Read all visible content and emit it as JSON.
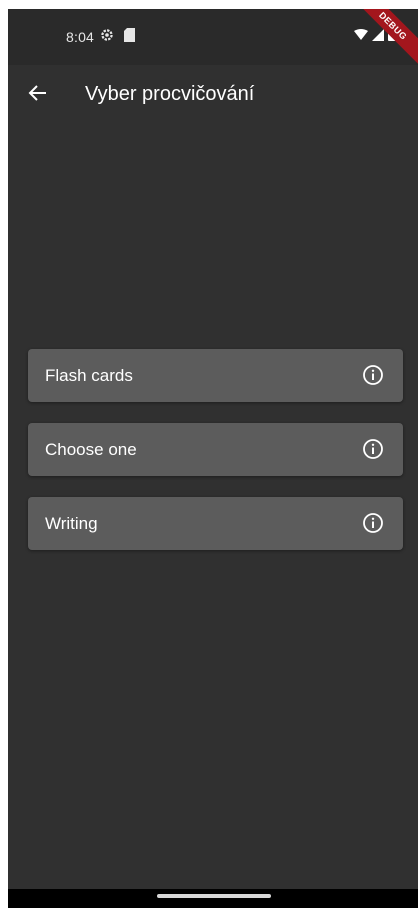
{
  "status_bar": {
    "time": "8:04",
    "left_icons": [
      "settings-gear-icon",
      "sd-card-icon"
    ],
    "right_icons": [
      "wifi-icon",
      "signal-icon",
      "battery-icon"
    ],
    "debug_label": "DEBUG"
  },
  "app_bar": {
    "back_icon": "arrow-back-icon",
    "title": "Vyber procvičování"
  },
  "options": [
    {
      "label": "Flash cards",
      "icon": "info-icon"
    },
    {
      "label": "Choose one",
      "icon": "info-icon"
    },
    {
      "label": "Writing",
      "icon": "info-icon"
    }
  ],
  "colors": {
    "background": "#303030",
    "status_bar": "#2a2a2a",
    "option_background": "#5c5c5c",
    "text": "#ffffff",
    "debug_banner": "#a3161d",
    "nav_bar": "#000000"
  }
}
